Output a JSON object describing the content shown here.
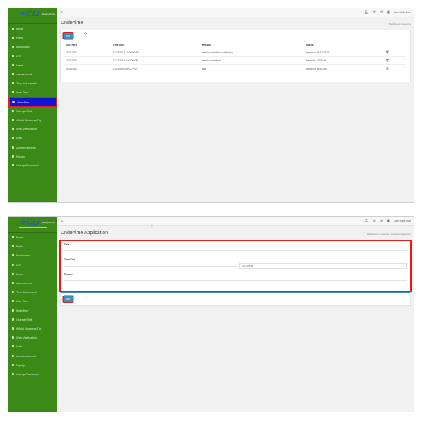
{
  "app": {
    "logo_prefix": "my",
    "logo_name": "CLI",
    "logo_tagline": "Employee Portal"
  },
  "sidebar": {
    "items": [
      {
        "label": "Home",
        "icon": "home-icon"
      },
      {
        "label": "Profile",
        "icon": "user-icon"
      },
      {
        "label": "Dashboard",
        "icon": "dashboard-icon"
      },
      {
        "label": "DTR",
        "icon": "clock-icon"
      },
      {
        "label": "Leave",
        "icon": "calendar-icon"
      },
      {
        "label": "Assessments",
        "icon": "clipboard-icon"
      },
      {
        "label": "Time Adjustment",
        "icon": "clock-icon"
      },
      {
        "label": "Over Time",
        "icon": "clock-icon"
      },
      {
        "label": "Undertime",
        "icon": "clock-icon"
      },
      {
        "label": "Change Shift",
        "icon": "swap-icon"
      },
      {
        "label": "Official Business Trip",
        "icon": "briefcase-icon"
      },
      {
        "label": "Work Verification",
        "icon": "check-icon"
      },
      {
        "label": "Loan",
        "icon": "money-icon"
      },
      {
        "label": "Announcements",
        "icon": "bell-icon"
      },
      {
        "label": "Payslip",
        "icon": "document-icon"
      },
      {
        "label": "Change Password",
        "icon": "key-icon"
      }
    ],
    "active_index": 8
  },
  "topbar": {
    "user_name": "Juan Dela Cruz",
    "icons": [
      "hamburger-icon",
      "bell-icon",
      "gear-icon",
      "envelope-icon",
      "avatar"
    ]
  },
  "list_view": {
    "title": "Undertime",
    "breadcrumb": "Dashboard  ›  Undertime",
    "new_button": "New",
    "columns": [
      "Date Filed",
      "Time Out",
      "Reason",
      "Status"
    ],
    "rows": [
      {
        "date": "11/21/2019",
        "time": "11/25/2019 10:00:00 AM",
        "reason": "test for undertime notification",
        "status": "Approved 11/21/2019"
      },
      {
        "date": "11/22/2019",
        "time": "11/22/2019 3:00:00 PM",
        "reason": "test for undertime",
        "status": "Denied 11/22/2019"
      },
      {
        "date": "11/05/2019",
        "time": "11/5/2019 4:00:00 PM",
        "reason": "test",
        "status": "Approved 11/6/2019"
      }
    ]
  },
  "form_view": {
    "title": "Undertime Application",
    "breadcrumb": "Dashboard  ›  Undertime  ›  Undertime Application",
    "labels": {
      "date": "Date",
      "time_out": "Time Out",
      "reason": "Reason"
    },
    "time_value": "10:30 PM",
    "save_button": "Save"
  },
  "colors": {
    "sidebar": "#3b8a17",
    "active_item": "#1414d4",
    "highlight": "#e21e1e",
    "primary": "#3c8dbc"
  }
}
